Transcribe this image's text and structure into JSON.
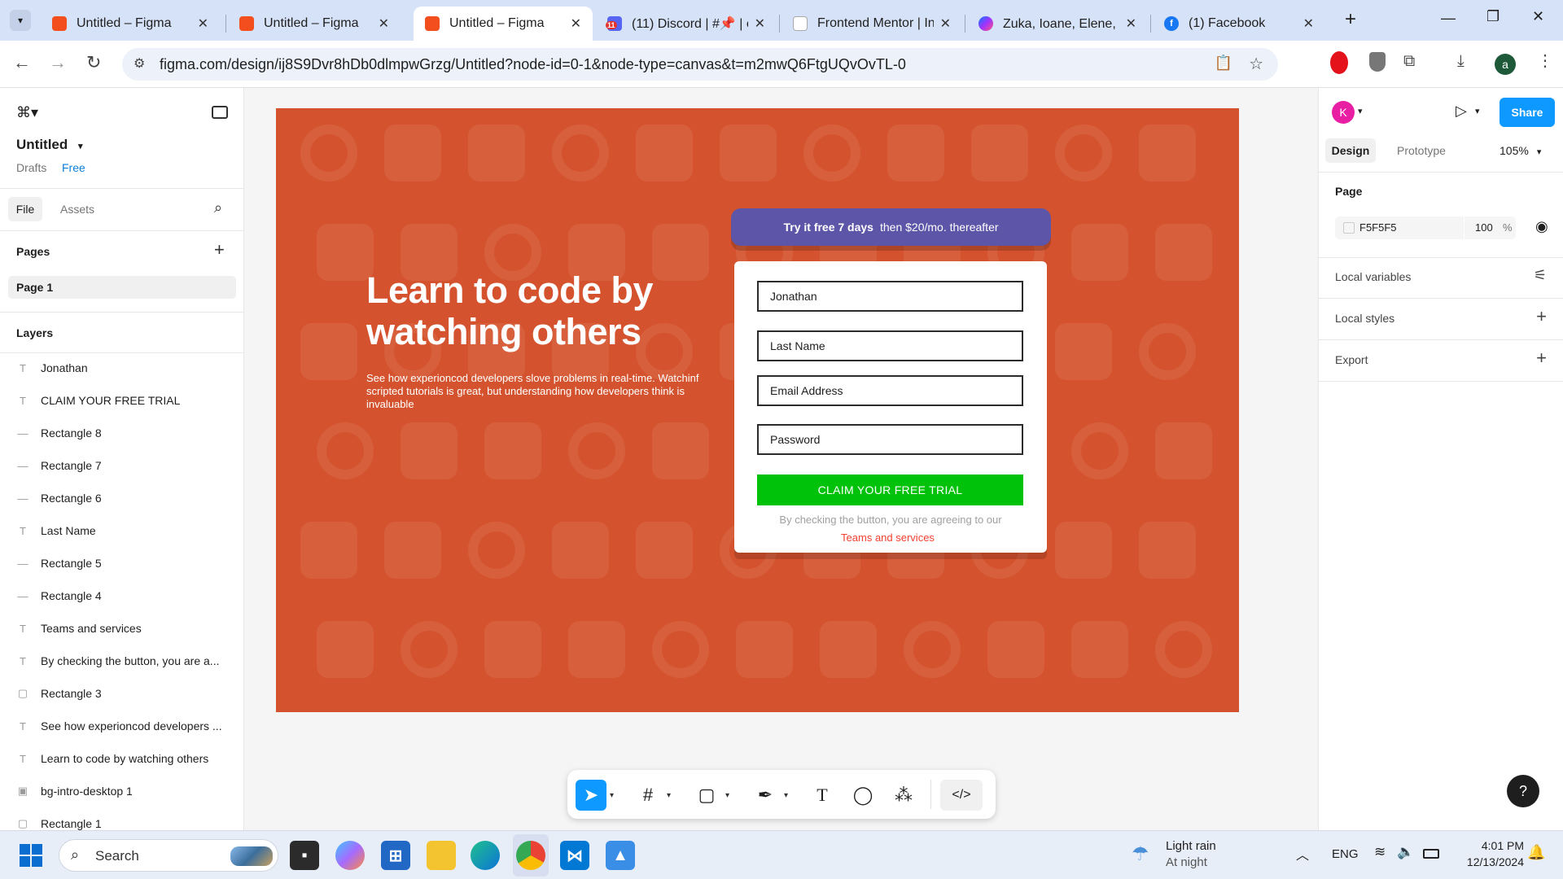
{
  "browser": {
    "tabs": [
      {
        "title": "Untitled – Figma",
        "icon": "figma-icon"
      },
      {
        "title": "Untitled – Figma",
        "icon": "figma-icon"
      },
      {
        "title": "Untitled – Figma",
        "icon": "figma-icon"
      },
      {
        "title": "(11) Discord | #📌 | c",
        "icon": "discord-icon"
      },
      {
        "title": "Frontend Mentor | In",
        "icon": "frontend-mentor-icon"
      },
      {
        "title": "Zuka, Ioane, Elene, 🙂",
        "icon": "messenger-icon"
      },
      {
        "title": "(1) Facebook",
        "icon": "facebook-icon"
      }
    ],
    "discord_badge": "11",
    "url": "figma.com/design/ij8S9Dvr8hDb0dlmpwGrzg/Untitled?node-id=0-1&node-type=canvas&t=m2mwQ6FtgUQvOvTL-0",
    "profile_initial": "a"
  },
  "figma": {
    "file_name": "Untitled",
    "drafts_label": "Drafts",
    "plan_label": "Free",
    "tab_file": "File",
    "tab_assets": "Assets",
    "pages_label": "Pages",
    "pages": [
      "Page 1"
    ],
    "layers_label": "Layers",
    "layers": [
      {
        "name": "Jonathan",
        "type": "text"
      },
      {
        "name": "CLAIM YOUR FREE TRIAL",
        "type": "text"
      },
      {
        "name": "Rectangle 8",
        "type": "line"
      },
      {
        "name": "Rectangle 7",
        "type": "line"
      },
      {
        "name": "Rectangle 6",
        "type": "line"
      },
      {
        "name": "Last Name",
        "type": "text"
      },
      {
        "name": "Rectangle 5",
        "type": "line"
      },
      {
        "name": "Rectangle 4",
        "type": "line"
      },
      {
        "name": "Teams and services",
        "type": "text"
      },
      {
        "name": "By checking the button, you are a...",
        "type": "text"
      },
      {
        "name": "Rectangle 3",
        "type": "rect"
      },
      {
        "name": "See how experioncod developers ...",
        "type": "text"
      },
      {
        "name": "Learn to code by watching others",
        "type": "text"
      },
      {
        "name": "bg-intro-desktop 1",
        "type": "image"
      },
      {
        "name": "Rectangle 1",
        "type": "rect"
      }
    ],
    "right_panel": {
      "avatar_initial": "K",
      "share_label": "Share",
      "tab_design": "Design",
      "tab_prototype": "Prototype",
      "zoom": "105%",
      "page_label": "Page",
      "page_color": "F5F5F5",
      "page_opacity": "100",
      "percent": "%",
      "local_variables": "Local variables",
      "local_styles": "Local styles",
      "export": "Export"
    }
  },
  "design": {
    "headline": "Learn to code by watching others",
    "subtext": "See how experioncod developers slove problems in real-time. Watchinf scripted tutorials is great, but understanding how developers think is invaluable",
    "promo_bold": "Try it free 7 days",
    "promo_rest": "then $20/mo. thereafter",
    "fields": [
      "Jonathan",
      "Last Name",
      "Email Address",
      "Password"
    ],
    "cta": "CLAIM YOUR FREE TRIAL",
    "terms_line": "By checking the button, you are agreeing to our",
    "terms_link": "Teams and services",
    "colors": {
      "background": "#d4532e",
      "promo": "#5d55a8",
      "cta": "#00c20a",
      "link": "#f2402f"
    }
  },
  "taskbar": {
    "search": "Search",
    "weather_title": "Light rain",
    "weather_sub": "At night",
    "lang": "ENG",
    "time": "4:01 PM",
    "date": "12/13/2024"
  }
}
